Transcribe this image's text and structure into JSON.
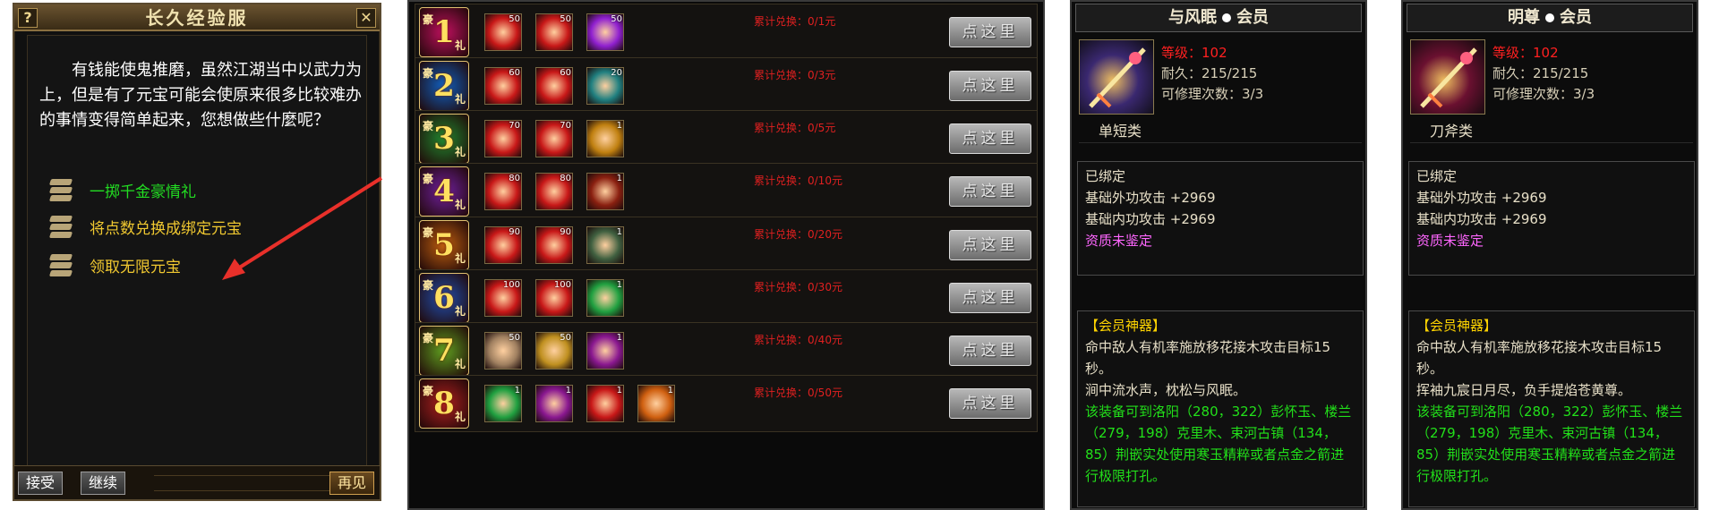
{
  "npc": {
    "title": "长久经验服",
    "help_glyph": "?",
    "close_glyph": "✕",
    "text": "有钱能使鬼推磨，虽然江湖当中以武力为上，但是有了元宝可能会使原来很多比较难办的事情变得简单起来，您想做些什麼呢？",
    "options": [
      {
        "label": "一掷千金豪情礼",
        "color": "#22dd22"
      },
      {
        "label": "将点数兑换成绑定元宝",
        "color": "#f0c830"
      },
      {
        "label": "领取无限元宝",
        "color": "#f0c830"
      }
    ],
    "buttons": {
      "accept": "接受",
      "continue": "继续",
      "goodbye": "再见"
    },
    "colors": {
      "arrow": "#e8302a"
    }
  },
  "rewards": {
    "rows": [
      {
        "num": "1",
        "cap": "豪",
        "cap2": "礼",
        "badge_color": "#c01060",
        "items": [
          {
            "count": "50",
            "icon": "red-fireworks-icon",
            "color": "#c81818"
          },
          {
            "count": "50",
            "icon": "red-fireworks-icon",
            "color": "#c81818"
          },
          {
            "count": "50",
            "icon": "purple-orb-icon",
            "color": "#9020d0"
          }
        ],
        "progress": "累计兑换：0/1元",
        "button": "点这里"
      },
      {
        "num": "2",
        "cap": "豪",
        "cap2": "礼",
        "badge_color": "#1060c0",
        "items": [
          {
            "count": "60",
            "icon": "red-fireworks-icon",
            "color": "#c81818"
          },
          {
            "count": "60",
            "icon": "red-fireworks-icon",
            "color": "#c81818"
          },
          {
            "count": "20",
            "icon": "cyan-gem-icon",
            "color": "#208080"
          }
        ],
        "progress": "累计兑换：0/3元",
        "button": "点这里"
      },
      {
        "num": "3",
        "cap": "豪",
        "cap2": "礼",
        "badge_color": "#208830",
        "items": [
          {
            "count": "70",
            "icon": "red-fireworks-icon",
            "color": "#c81818"
          },
          {
            "count": "70",
            "icon": "red-fireworks-icon",
            "color": "#c81818"
          },
          {
            "count": "1",
            "icon": "golden-egg-icon",
            "color": "#c08010"
          }
        ],
        "progress": "累计兑换：0/5元",
        "button": "点这里"
      },
      {
        "num": "4",
        "cap": "豪",
        "cap2": "礼",
        "badge_color": "#7020a0",
        "items": [
          {
            "count": "80",
            "icon": "red-fireworks-icon",
            "color": "#c81818"
          },
          {
            "count": "80",
            "icon": "red-fireworks-icon",
            "color": "#c81818"
          },
          {
            "count": "1",
            "icon": "dragon-emblem-icon",
            "color": "#8a2010"
          }
        ],
        "progress": "累计兑换：0/10元",
        "button": "点这里"
      },
      {
        "num": "5",
        "cap": "豪",
        "cap2": "礼",
        "badge_color": "#c06010",
        "items": [
          {
            "count": "90",
            "icon": "red-fireworks-icon",
            "color": "#c81818"
          },
          {
            "count": "90",
            "icon": "red-fireworks-icon",
            "color": "#c81818"
          },
          {
            "count": "1",
            "icon": "spirit-mask-icon",
            "color": "#406040"
          }
        ],
        "progress": "累计兑换：0/20元",
        "button": "点这里"
      },
      {
        "num": "6",
        "cap": "豪",
        "cap2": "礼",
        "badge_color": "#2050b0",
        "items": [
          {
            "count": "100",
            "icon": "red-fireworks-icon",
            "color": "#c81818"
          },
          {
            "count": "100",
            "icon": "red-fireworks-icon",
            "color": "#c81818"
          },
          {
            "count": "1",
            "icon": "red-pouch-icon",
            "color": "#20a040"
          }
        ],
        "progress": "累计兑换：0/30元",
        "button": "点这里"
      },
      {
        "num": "7",
        "cap": "豪",
        "cap2": "礼",
        "badge_color": "#60a020",
        "items": [
          {
            "count": "50",
            "icon": "scroll-paper-icon",
            "color": "#a08060"
          },
          {
            "count": "50",
            "icon": "card-bundle-icon",
            "color": "#c09020"
          },
          {
            "count": "1",
            "icon": "gold-token-icon",
            "color": "#8a1890"
          }
        ],
        "progress": "累计兑换：0/40元",
        "button": "点这里"
      },
      {
        "num": "8",
        "cap": "豪",
        "cap2": "礼",
        "badge_color": "#b02020",
        "items": [
          {
            "count": "1",
            "icon": "red-pouch-icon",
            "color": "#20a040"
          },
          {
            "count": "1",
            "icon": "gold-token-icon",
            "color": "#8a1890"
          },
          {
            "count": "1",
            "icon": "red-fireworks-icon",
            "color": "#c81818"
          },
          {
            "count": "1",
            "icon": "gift-box-icon",
            "color": "#d06010"
          }
        ],
        "progress": "累计兑换：0/50元",
        "button": "点这里"
      }
    ]
  },
  "tooltips": [
    {
      "name": "与风眠",
      "tag": "会员",
      "level": "等级：102",
      "durability": "耐久：215/215",
      "repairs": "可修理次数：3/3",
      "type": "单短类",
      "icon_color": "#3a2870",
      "bound": "已绑定",
      "attack_ext": "基础外功攻击 +2969",
      "attack_int": "基础内功攻击 +2969",
      "quality": "资质未鉴定",
      "set_title": "【会员神器】",
      "effect": "命中敌人有机率施放移花接木攻击目标15秒。",
      "flavor": "涧中流水声，枕松与风眠。",
      "socket": "该装备可到洛阳（280，322）彭怀玉、楼兰（279，198）克里木、束河古镇（134，85）荆嵌实处使用寒玉精粹或者点金之箭进行极限打孔。"
    },
    {
      "name": "明尊",
      "tag": "会员",
      "level": "等级：102",
      "durability": "耐久：215/215",
      "repairs": "可修理次数：3/3",
      "type": "刀斧类",
      "icon_color": "#6a1030",
      "bound": "已绑定",
      "attack_ext": "基础外功攻击 +2969",
      "attack_int": "基础内功攻击 +2969",
      "quality": "资质未鉴定",
      "set_title": "【会员神器】",
      "effect": "命中敌人有机率施放移花接木攻击目标15秒。",
      "flavor": "挥袖九宸日月尽，负手提焰苍黄尊。",
      "socket": "该装备可到洛阳（280，322）彭怀玉、楼兰（279，198）克里木、束河古镇（134，85）荆嵌实处使用寒玉精粹或者点金之箭进行极限打孔。"
    }
  ]
}
